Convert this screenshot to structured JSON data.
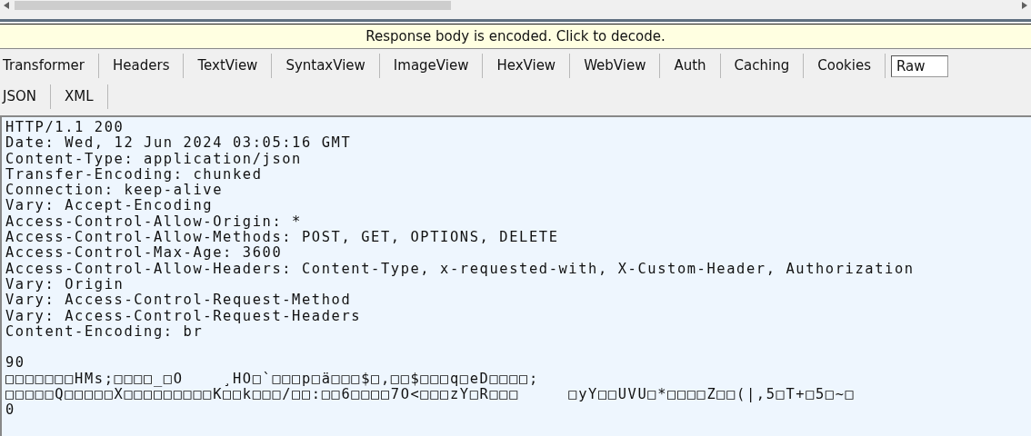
{
  "notice_bar": {
    "text": "Response body is encoded. Click to decode."
  },
  "inspector_tabs": [
    {
      "label": "Transformer",
      "selected": false
    },
    {
      "label": "Headers",
      "selected": false
    },
    {
      "label": "TextView",
      "selected": false
    },
    {
      "label": "SyntaxView",
      "selected": false
    },
    {
      "label": "ImageView",
      "selected": false
    },
    {
      "label": "HexView",
      "selected": false
    },
    {
      "label": "WebView",
      "selected": false
    },
    {
      "label": "Auth",
      "selected": false
    },
    {
      "label": "Caching",
      "selected": false
    },
    {
      "label": "Cookies",
      "selected": false
    },
    {
      "label": "Raw",
      "selected": true
    }
  ],
  "format_tabs": [
    {
      "label": "JSON",
      "selected": false
    },
    {
      "label": "XML",
      "selected": false
    }
  ],
  "raw_response": {
    "header_lines": [
      "HTTP/1.1 200",
      "Date: Wed, 12 Jun 2024 03:05:16 GMT",
      "Content-Type: application/json",
      "Transfer-Encoding: chunked",
      "Connection: keep-alive",
      "Vary: Accept-Encoding",
      "Access-Control-Allow-Origin: *",
      "Access-Control-Allow-Methods: POST, GET, OPTIONS, DELETE",
      "Access-Control-Max-Age: 3600",
      "Access-Control-Allow-Headers: Content-Type, x-requested-with, X-Custom-Header, Authorization",
      "Vary: Origin",
      "Vary: Access-Control-Request-Method",
      "Vary: Access-Control-Request-Headers",
      "Content-Encoding: br"
    ],
    "body_lines": [
      "90",
      "□□□□□□□HMs;□□□□_□O    ¸HO□`□□□p□ä□□□$□,□□$□□□q□eD□□□□;",
      "□□□□□Q□□□□□X□□□□□□□□□K□□k□□□/□□:□□6□□□□7O<□□□zY□R□□□     □yY□□UVU□*□□□□Z□□(|,5□T+□5□~□",
      "0"
    ]
  }
}
